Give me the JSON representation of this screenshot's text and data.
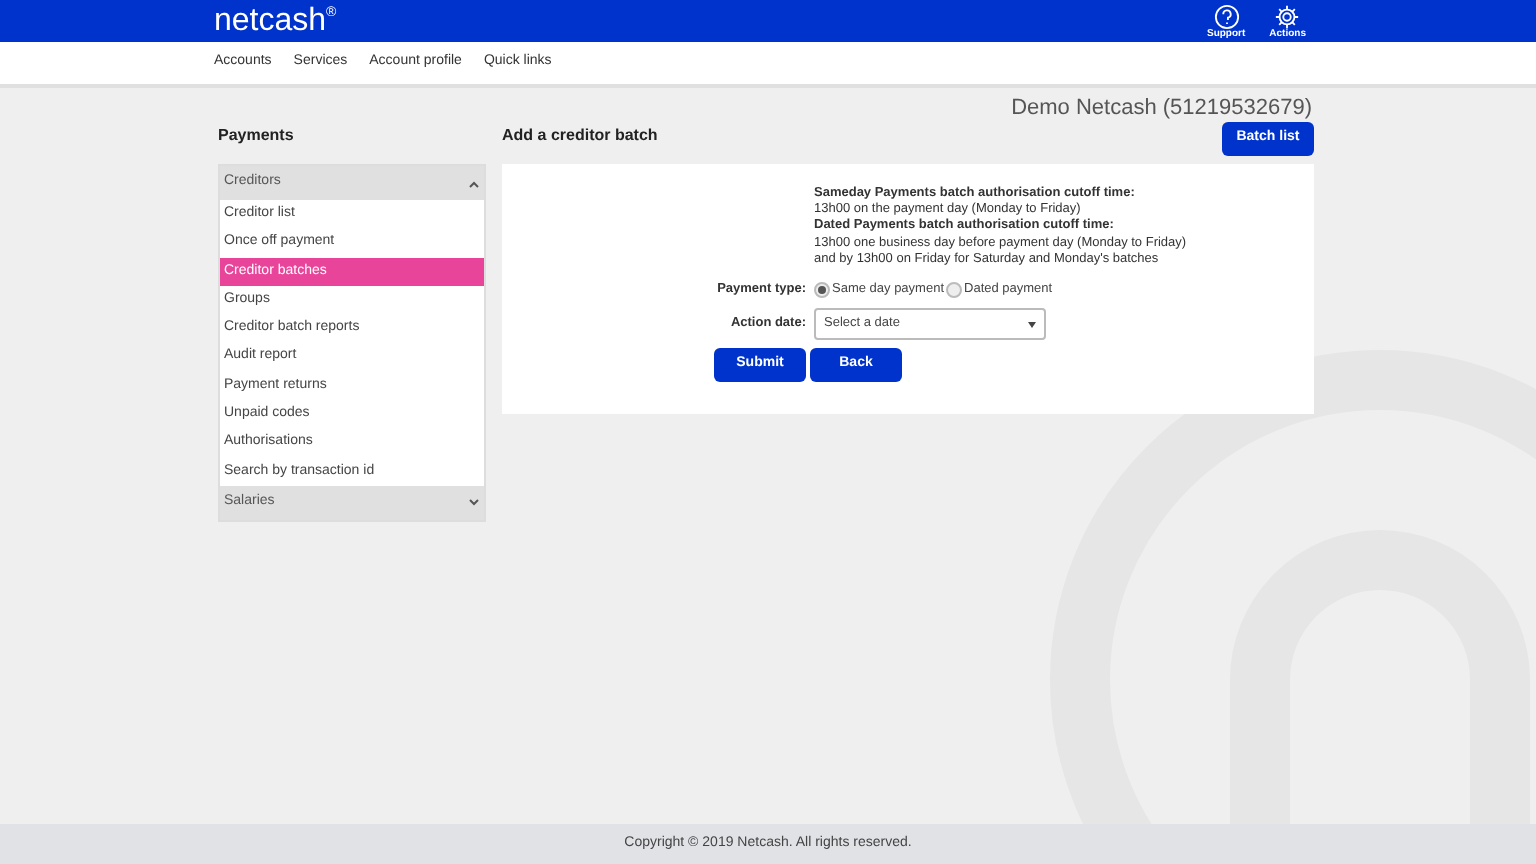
{
  "header": {
    "logo": "netcash",
    "logo_mark": "®",
    "actions": [
      {
        "label": "Support",
        "kind": "help"
      },
      {
        "label": "Actions",
        "kind": "gear"
      }
    ]
  },
  "nav": [
    "Accounts",
    "Services",
    "Account profile",
    "Quick links"
  ],
  "account_name": "Demo Netcash (51219532679)",
  "sidebar": {
    "title": "Payments",
    "groups": [
      {
        "label": "Creditors",
        "expanded": true,
        "items": [
          {
            "label": "Creditor list",
            "selected": false
          },
          {
            "label": "Once off payment",
            "selected": false
          },
          {
            "label": "Creditor batches",
            "selected": true
          },
          {
            "label": "Groups",
            "selected": false
          },
          {
            "label": "Creditor batch reports",
            "selected": false
          },
          {
            "label": "Audit report",
            "selected": false
          },
          {
            "label": "Payment returns",
            "selected": false
          },
          {
            "label": "Unpaid codes",
            "selected": false
          },
          {
            "label": "Authorisations",
            "selected": false
          },
          {
            "label": "Search by transaction id",
            "selected": false
          }
        ]
      },
      {
        "label": "Salaries",
        "expanded": false
      }
    ]
  },
  "main": {
    "title": "Add a creditor batch",
    "batch_list_button": "Batch list",
    "info": [
      {
        "text": "Sameday Payments batch authorisation cutoff time:",
        "bold": true
      },
      {
        "text": "13h00 on the payment day (Monday to Friday)",
        "bold": false
      },
      {
        "text": "Dated Payments batch authorisation cutoff time:",
        "bold": true
      },
      {
        "text": "13h00 one business day before payment day (Monday to Friday)",
        "bold": false
      },
      {
        "text": "and by 13h00 on Friday for Saturday and Monday's batches",
        "bold": false
      }
    ],
    "payment_type": {
      "label": "Payment type:",
      "options": [
        {
          "label": "Same day payment",
          "selected": true
        },
        {
          "label": "Dated payment",
          "selected": false
        }
      ]
    },
    "action_date": {
      "label": "Action date:",
      "value": "Select a date"
    },
    "buttons": [
      "Submit",
      "Back"
    ]
  },
  "footer": "Copyright © 2019 Netcash. All rights reserved."
}
